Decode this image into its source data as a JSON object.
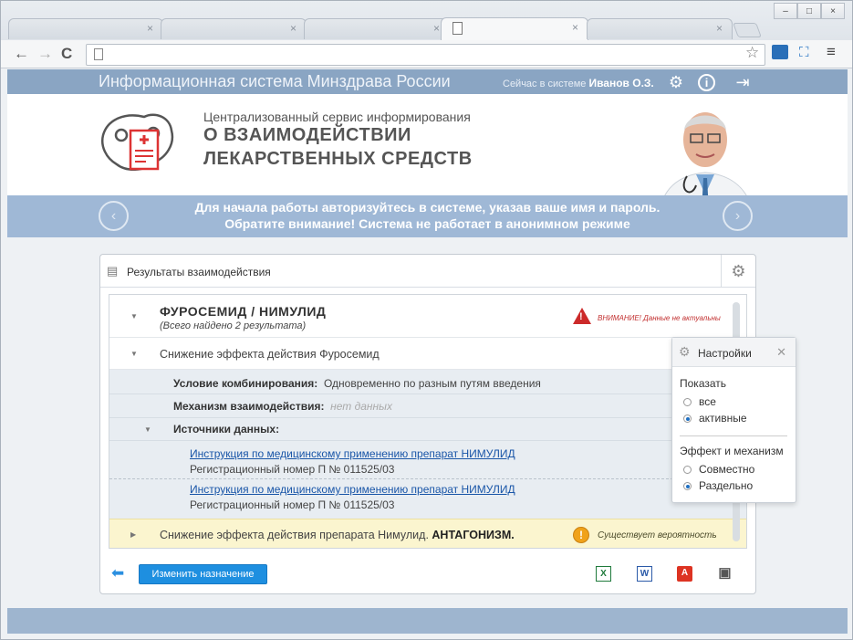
{
  "browser": {
    "tabs": [
      {
        "close": "×"
      },
      {
        "close": "×"
      },
      {
        "close": "×"
      },
      {
        "close": "×",
        "active": true
      },
      {
        "close": "×"
      }
    ],
    "window_buttons": [
      "–",
      "□",
      "×"
    ],
    "nav": {
      "back": "←",
      "forward": "→",
      "reload": "C"
    },
    "url": "",
    "icons": [
      "star-icon",
      "cast-icon",
      "fullscreen-icon",
      "menu-icon"
    ]
  },
  "app": {
    "title": "Информационная система Минздрава России",
    "user_prefix": "Сейчас в системе",
    "user_name": "Иванов О.З."
  },
  "banner": {
    "service_line1": "Централизованный сервис информирования",
    "service_line2": "О ВЗАИМОДЕЙСТВИИ",
    "service_line3": "ЛЕКАРСТВЕННЫХ СРЕДСТВ",
    "notice_line1": "Для начала работы авторизуйтесь в системе, указав ваше имя и пароль.",
    "notice_line2": "Обратите внимание! Система не работает в анонимном режиме"
  },
  "panel": {
    "title": "Результаты взаимодействия",
    "drugs": "ФУРОСЕМИД / НИМУЛИД",
    "found": "(Всего найдено 2 результата)",
    "warning": "ВНИМАНИЕ! Данные не актуальны",
    "effect1": "Снижение эффекта действия Фуросемид",
    "cond_label": "Условие комбинирования:",
    "cond_value": "Одновременно по разным путям введения",
    "mech_label": "Механизм взаимодействия:",
    "mech_value": "нет данных",
    "sources_label": "Источники данных:",
    "sources": [
      {
        "link": "Инструкция по медицинскому применению препарат НИМУЛИД",
        "reg": "Регистрационный номер П № 011525/03"
      },
      {
        "link": "Инструкция по медицинскому применению препарат НИМУЛИД",
        "reg": "Регистрационный номер П № 011525/03"
      }
    ],
    "effect2": "Снижение эффекта действия препарата Нимулид.",
    "effect2_type": "АНТАГОНИЗМ.",
    "probability": "Существует вероятность",
    "change_button": "Изменить назначение"
  },
  "settings": {
    "title": "Настройки",
    "show_label": "Показать",
    "show_options": [
      {
        "label": "все",
        "selected": false
      },
      {
        "label": "активные",
        "selected": true
      }
    ],
    "effect_label": "Эффект и механизм",
    "effect_options": [
      {
        "label": "Совместно",
        "selected": false
      },
      {
        "label": "Раздельно",
        "selected": true
      }
    ]
  },
  "colors": {
    "header": "#8aa5c3",
    "notice": "#9fb8d6",
    "primary_button": "#1e8fe0",
    "warning_red": "#cc2a2a",
    "highlight_row": "#fbf5cf"
  }
}
